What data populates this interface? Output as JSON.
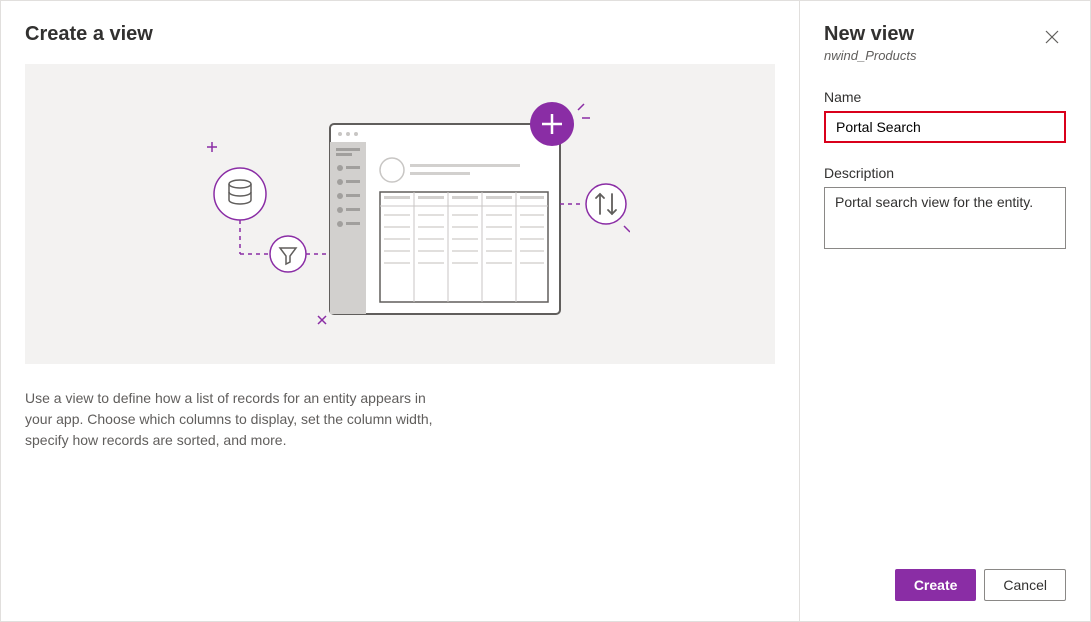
{
  "left": {
    "title": "Create a view",
    "help_text": "Use a view to define how a list of records for an entity appears in your app. Choose which columns to display, set the column width, specify how records are sorted, and more."
  },
  "right": {
    "title": "New view",
    "subtitle": "nwind_Products",
    "name_label": "Name",
    "name_value": "Portal Search",
    "desc_label": "Description",
    "desc_value": "Portal search view for the entity."
  },
  "footer": {
    "create": "Create",
    "cancel": "Cancel"
  },
  "colors": {
    "accent": "#8a2da5",
    "highlight_border": "#d9001b"
  }
}
